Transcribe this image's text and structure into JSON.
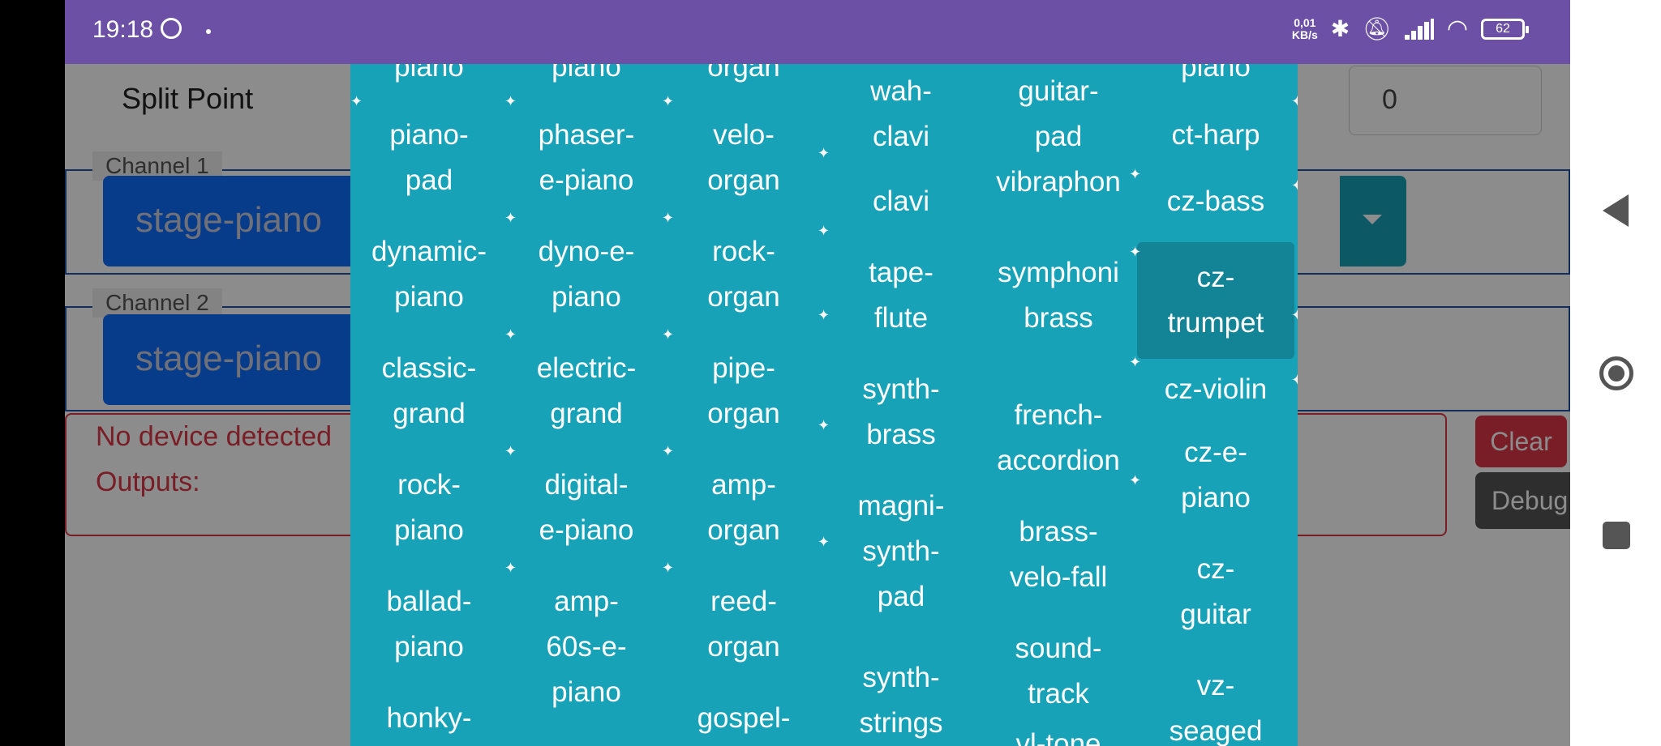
{
  "status_bar": {
    "time": "19:18",
    "net_speed_value": "0,01",
    "net_speed_unit": "KB/s",
    "battery": "62",
    "icons": [
      "whatsapp-icon",
      "bluetooth-icon",
      "bell-muted-icon",
      "signal-icon",
      "wifi-icon",
      "battery-icon"
    ]
  },
  "app": {
    "split_point_label": "Split Point",
    "split_point_value": "0",
    "channel1": {
      "label": "Channel 1",
      "value": "stage-piano"
    },
    "channel2": {
      "label": "Channel 2",
      "value": "stage-piano"
    },
    "log": {
      "line1": "No device detected",
      "line2": "Outputs:"
    },
    "clear_label": "Clear",
    "debug_label": "Debug"
  },
  "dropdown": {
    "columns": [
      [
        "piano",
        "piano-\npad",
        "dynamic-\npiano",
        "classic-\ngrand",
        "rock-\npiano",
        "ballad-\npiano",
        "honky-"
      ],
      [
        "piano",
        "phaser-\ne-piano",
        "dyno-e-\npiano",
        "electric-\ngrand",
        "digital-\ne-piano",
        "amp-\n60s-e-\npiano"
      ],
      [
        "organ",
        "velo-\norgan",
        "rock-\norgan",
        "pipe-\norgan",
        "amp-\norgan",
        "reed-\norgan",
        "gospel-"
      ],
      [
        "wah-\nclavi",
        "clavi",
        "tape-\nflute",
        "synth-\nbrass",
        "magni-\nsynth-\npad",
        "synth-\nstrings"
      ],
      [
        "guitar-\npad",
        "vibraphon",
        "symphoni\nbrass",
        "french-\naccordion",
        "brass-\nvelo-fall",
        "sound-\ntrack",
        "vl-tone"
      ],
      [
        "piano",
        "ct-harp",
        "cz-bass",
        "cz-\ntrumpet",
        "cz-violin",
        "cz-e-\npiano",
        "cz-\nguitar",
        "vz-\nseaged"
      ]
    ],
    "highlighted": "cz-\ntrumpet"
  },
  "navbar": {
    "icons": [
      "back-icon",
      "home-icon",
      "recents-icon"
    ]
  }
}
